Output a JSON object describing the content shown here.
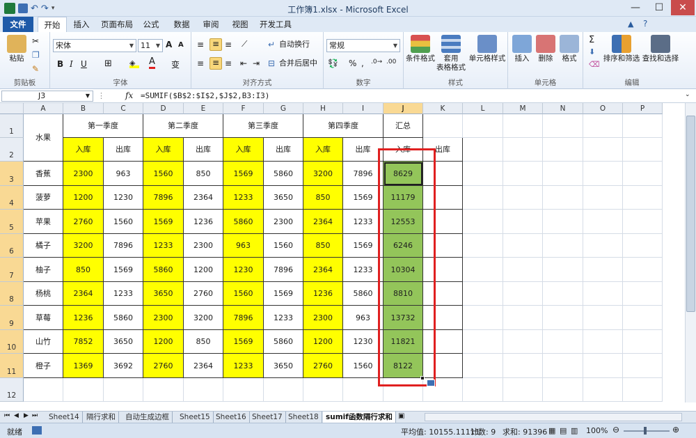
{
  "window": {
    "title": "工作簿1.xlsx - Microsoft Excel"
  },
  "tabs": [
    "文件",
    "开始",
    "插入",
    "页面布局",
    "公式",
    "数据",
    "审阅",
    "视图",
    "开发工具"
  ],
  "ribbon": {
    "clipboard": {
      "paste": "粘贴",
      "label": "剪贴板"
    },
    "font": {
      "name": "宋体",
      "size": "11",
      "label": "字体"
    },
    "align": {
      "wrap": "自动换行",
      "merge": "合并后居中",
      "label": "对齐方式"
    },
    "number": {
      "format": "常规",
      "label": "数字"
    },
    "styles": {
      "cond": "条件格式",
      "table1": "套用",
      "table2": "表格格式",
      "cell": "单元格样式",
      "label": "样式"
    },
    "cells": {
      "insert": "插入",
      "delete": "删除",
      "format": "格式",
      "label": "单元格"
    },
    "edit": {
      "sort": "排序和筛选",
      "find": "查找和选择",
      "label": "编辑"
    }
  },
  "formula_bar": {
    "name_box": "J3",
    "fx": "fx",
    "formula": "=SUMIF($B$2:$I$2,$J$2,B3:I3)"
  },
  "columns": [
    "A",
    "B",
    "C",
    "D",
    "E",
    "F",
    "G",
    "H",
    "I",
    "J",
    "K",
    "L",
    "M",
    "N",
    "O",
    "P"
  ],
  "rows": [
    "1",
    "2",
    "3",
    "4",
    "5",
    "6",
    "7",
    "8",
    "9",
    "10",
    "11",
    "12"
  ],
  "sheet": {
    "fruit_header": "水果",
    "quarters": [
      "第一季度",
      "第二季度",
      "第三季度",
      "第四季度",
      "汇总"
    ],
    "in_label": "入库",
    "out_label": "出库",
    "data": [
      {
        "fruit": "香蕉",
        "v": [
          "2300",
          "963",
          "1560",
          "850",
          "1569",
          "5860",
          "3200",
          "7896"
        ],
        "total": "8629"
      },
      {
        "fruit": "菠萝",
        "v": [
          "1200",
          "1230",
          "7896",
          "2364",
          "1233",
          "3650",
          "850",
          "1569"
        ],
        "total": "11179"
      },
      {
        "fruit": "苹果",
        "v": [
          "2760",
          "1560",
          "1569",
          "1236",
          "5860",
          "2300",
          "2364",
          "1233"
        ],
        "total": "12553"
      },
      {
        "fruit": "橘子",
        "v": [
          "3200",
          "7896",
          "1233",
          "2300",
          "963",
          "1560",
          "850",
          "1569"
        ],
        "total": "6246"
      },
      {
        "fruit": "柚子",
        "v": [
          "850",
          "1569",
          "5860",
          "1200",
          "1230",
          "7896",
          "2364",
          "1233"
        ],
        "total": "10304"
      },
      {
        "fruit": "杨桃",
        "v": [
          "2364",
          "1233",
          "3650",
          "2760",
          "1560",
          "1569",
          "1236",
          "5860"
        ],
        "total": "8810"
      },
      {
        "fruit": "草莓",
        "v": [
          "1236",
          "5860",
          "2300",
          "3200",
          "7896",
          "1233",
          "2300",
          "963"
        ],
        "total": "13732"
      },
      {
        "fruit": "山竹",
        "v": [
          "7852",
          "3650",
          "1200",
          "850",
          "1569",
          "5860",
          "1200",
          "1230"
        ],
        "total": "11821"
      },
      {
        "fruit": "橙子",
        "v": [
          "1369",
          "3692",
          "2760",
          "2364",
          "1233",
          "3650",
          "2760",
          "1560"
        ],
        "total": "8122"
      }
    ]
  },
  "sheet_tabs": [
    "Sheet14",
    "隔行求和",
    "自动生成边框",
    "Sheet15",
    "Sheet16",
    "Sheet17",
    "Sheet18",
    "sumif函数隔行求和"
  ],
  "status": {
    "ready": "就绪",
    "average": "平均值: 10155.11111",
    "count": "计数: 9",
    "sum": "求和: 91396",
    "zoom": "100%"
  },
  "colors": {
    "yellow": "#ffff00",
    "green": "#93c55a",
    "highlight": "#e02020"
  }
}
